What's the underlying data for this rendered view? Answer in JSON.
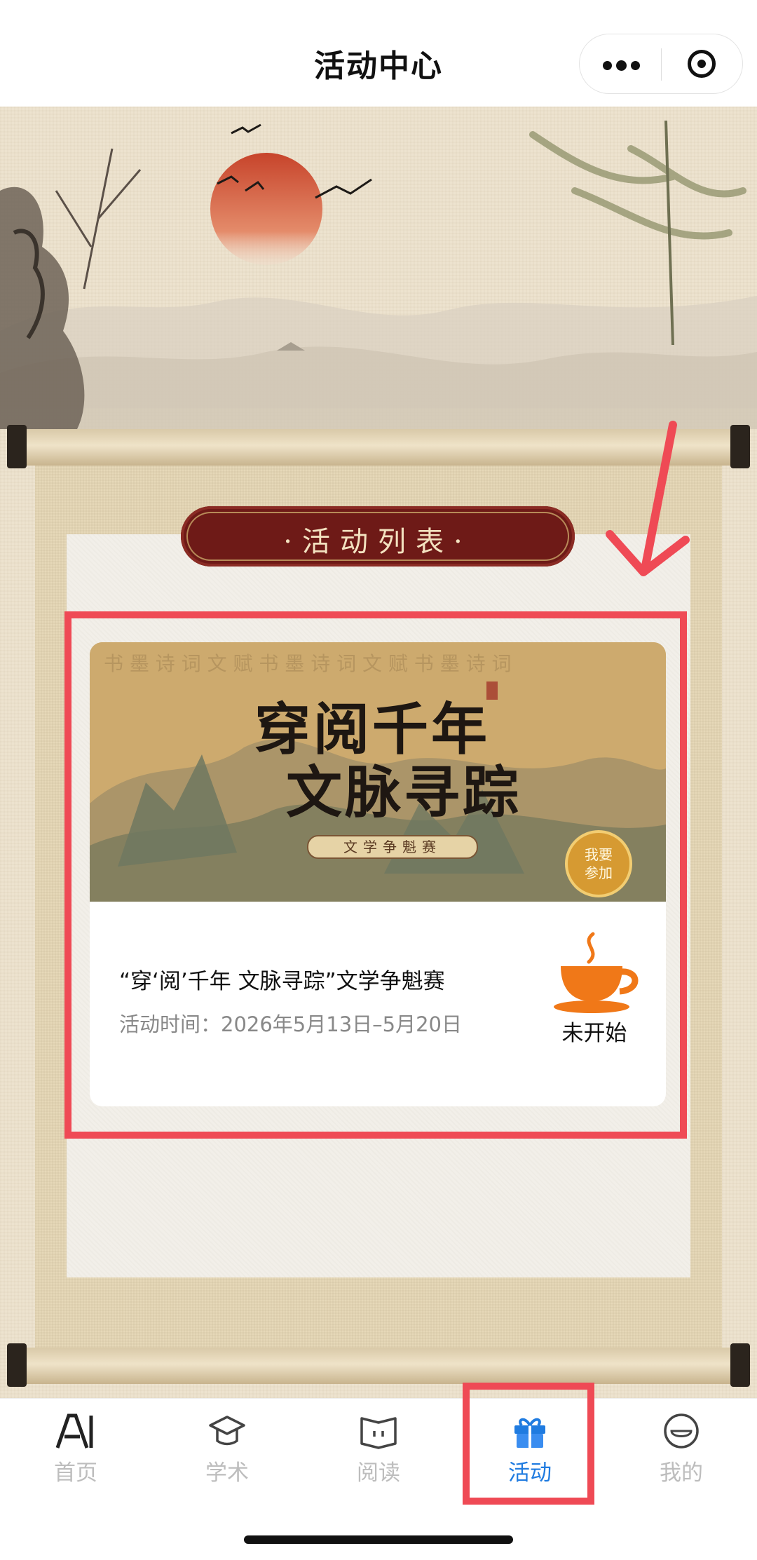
{
  "header": {
    "title": "活动中心",
    "more_icon": "more-dots-icon",
    "close_icon": "target-circle-icon"
  },
  "section": {
    "banner_title": "·活动列表·"
  },
  "activities": [
    {
      "banner_line1": "穿阅千年",
      "banner_line2": "文脉寻踪",
      "banner_sub": "文学争魁赛",
      "join_seal": "我要参加",
      "name": "“穿‘阅’千年 文脉寻踪”文学争魁赛",
      "time": "活动时间：2026年5月13日–5月20日",
      "status": "未开始",
      "status_icon": "coffee-cup-icon"
    }
  ],
  "tabbar": {
    "items": [
      {
        "label": "首页",
        "icon": "ai-logo-icon",
        "active": false
      },
      {
        "label": "学术",
        "icon": "graduation-cap-icon",
        "active": false
      },
      {
        "label": "阅读",
        "icon": "open-book-icon",
        "active": false
      },
      {
        "label": "活动",
        "icon": "gift-icon",
        "active": true
      },
      {
        "label": "我的",
        "icon": "smiley-face-icon",
        "active": false
      }
    ]
  },
  "colors": {
    "accent": "#1f7be0",
    "annotation": "#ef4a55",
    "status_icon": "#f07818",
    "banner_red": "#6e1a17"
  }
}
